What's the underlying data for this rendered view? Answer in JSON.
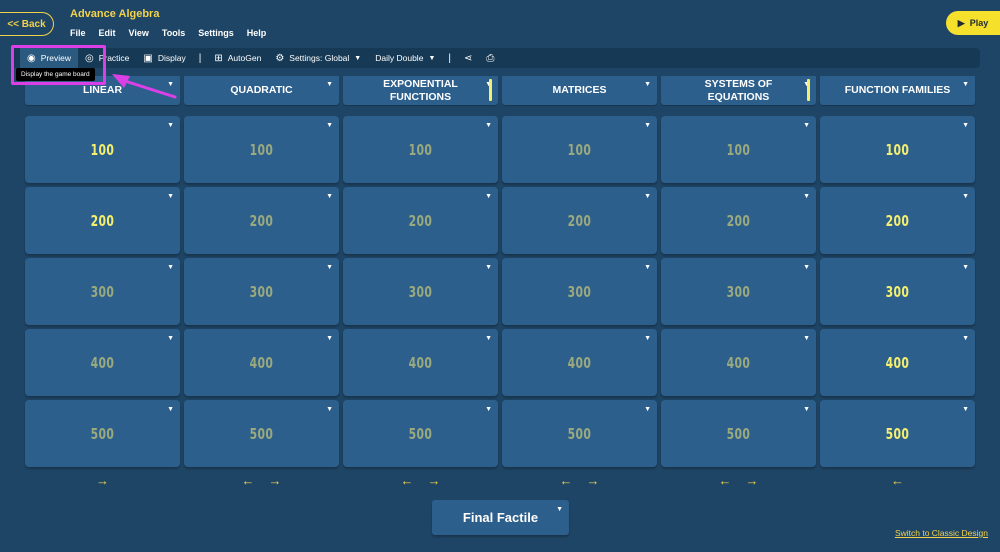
{
  "header": {
    "back_label": "<< Back",
    "title": "Advance Algebra",
    "menu": [
      "File",
      "Edit",
      "View",
      "Tools",
      "Settings",
      "Help"
    ],
    "play_label": "Play"
  },
  "toolbar": {
    "preview": "Preview",
    "practice": "Practice",
    "display": "Display",
    "autogen": "AutoGen",
    "settings": "Settings: Global",
    "daily_double": "Daily Double",
    "tooltip": "Display the game board"
  },
  "board": {
    "categories": [
      {
        "name": "LINEAR",
        "tall": false,
        "scroll": false
      },
      {
        "name": "QUADRATIC",
        "tall": false,
        "scroll": false
      },
      {
        "name": "EXPONENTIAL FUNCTIONS",
        "tall": true,
        "scroll": true
      },
      {
        "name": "MATRICES",
        "tall": false,
        "scroll": false
      },
      {
        "name": "SYSTEMS OF EQUATIONS",
        "tall": true,
        "scroll": true
      },
      {
        "name": "FUNCTION FAMILIES",
        "tall": false,
        "scroll": false
      }
    ],
    "values": [
      "100",
      "200",
      "300",
      "400",
      "500"
    ],
    "highlight": [
      [
        true,
        true,
        false,
        false,
        false
      ],
      [
        false,
        false,
        false,
        false,
        false
      ],
      [
        false,
        false,
        false,
        false,
        false
      ],
      [
        false,
        false,
        false,
        false,
        false
      ],
      [
        false,
        false,
        false,
        false,
        false
      ],
      [
        true,
        true,
        true,
        true,
        true
      ]
    ],
    "arrows": [
      [
        "→"
      ],
      [
        "←",
        "→"
      ],
      [
        "←",
        "→"
      ],
      [
        "←",
        "→"
      ],
      [
        "←",
        "→"
      ],
      [
        "←"
      ]
    ]
  },
  "final_label": "Final Factile",
  "switch_label": "Switch to Classic Design",
  "colors": {
    "background": "#1f4566",
    "tile": "#2d5f8c",
    "accent": "#f2d24a",
    "highlight": "#dd3fe6"
  }
}
